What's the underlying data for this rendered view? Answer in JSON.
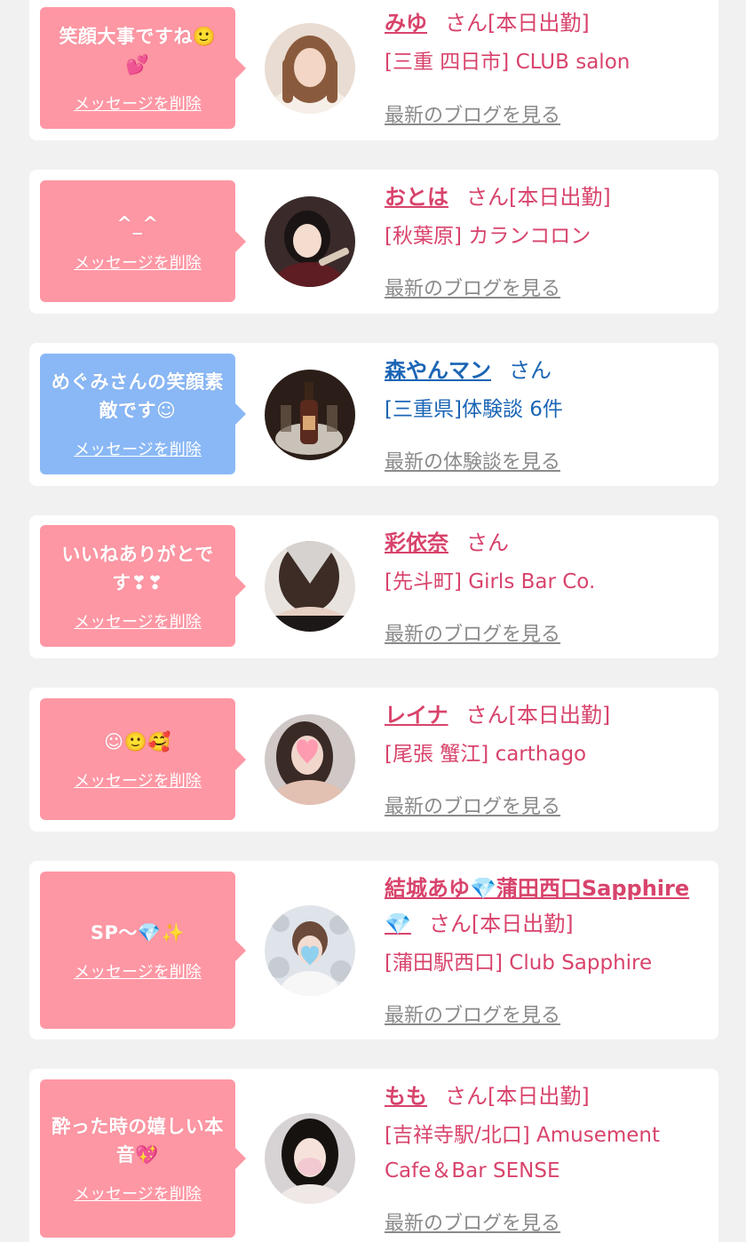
{
  "cards": [
    {
      "message": "笑顔大事ですね🙂💕",
      "delete_label": "メッセージを削除",
      "name": "みゆ",
      "suffix": "さん[本日出勤]",
      "shop": "[三重 四日市] CLUB salon",
      "blog_link": "最新のブログを見る",
      "bubble_color": "#fe97a4",
      "avatar": "avatar-photo"
    },
    {
      "message": "^_^",
      "delete_label": "メッセージを削除",
      "name": "おとは",
      "suffix": "さん[本日出勤]",
      "shop": "[秋葉原] カランコロン",
      "blog_link": "最新のブログを見る",
      "bubble_color": "#fe97a4",
      "avatar": "avatar-photo"
    },
    {
      "message": "めぐみさんの笑顔素敵です☺",
      "delete_label": "メッセージを削除",
      "name": "森やんマン",
      "suffix": "さん",
      "shop": "[三重県]体験談 6件",
      "blog_link": "最新の体験談を見る",
      "bubble_color": "#8ab8f6",
      "avatar": "avatar-photo"
    },
    {
      "message": "いいねありがとです❣❣",
      "delete_label": "メッセージを削除",
      "name": "彩依奈",
      "suffix": "さん",
      "shop": "[先斗町] Girls Bar Co.",
      "blog_link": "最新のブログを見る",
      "bubble_color": "#fe97a4",
      "avatar": "avatar-photo"
    },
    {
      "message": "☺🙂🥰",
      "delete_label": "メッセージを削除",
      "name": "レイナ",
      "suffix": "さん[本日出勤]",
      "shop": "[尾張 蟹江] carthago",
      "blog_link": "最新のブログを見る",
      "bubble_color": "#fe97a4",
      "avatar": "avatar-photo"
    },
    {
      "message": "SP～💎✨",
      "delete_label": "メッセージを削除",
      "name": "結城あゆ💎蒲田西口Sapphire💎",
      "suffix": "さん[本日出勤]",
      "shop": "[蒲田駅西口] Club Sapphire",
      "blog_link": "最新のブログを見る",
      "bubble_color": "#fe97a4",
      "avatar": "avatar-photo"
    },
    {
      "message": "酔った時の嬉しい本音💖",
      "delete_label": "メッセージを削除",
      "name": "もも",
      "suffix": "さん[本日出勤]",
      "shop": "[吉祥寺駅/北口] Amusement Cafe＆Bar SENSE",
      "blog_link": "最新のブログを見る",
      "bubble_color": "#fe97a4",
      "avatar": "avatar-photo"
    }
  ]
}
